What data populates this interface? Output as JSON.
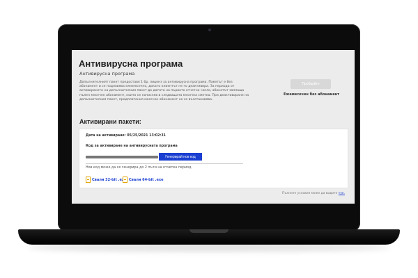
{
  "page": {
    "title": "Антивирусна програма",
    "subtitle": "Антивирусна програма",
    "description": "Допълнителният пакет предоставя 1 бр. лиценз за антивирусна програма. Пакетът е без абонамент и се подновява ежемесечно, докато клиентът не го деактивира. За периода от активирането на допълнителния пакет до датата на първото отчетно число, абонатът заплаща пълен месечен абонамент, които се начисляв в следващата месечна сметка. При деактивиране на допълнителния пакет, предплатения месечен абонамент не се възстановява.",
    "inactive_button": "Пробвайте",
    "monthly_label": "Ежемесечен без абонамент",
    "section_title": "Активирани пакети:"
  },
  "package": {
    "activation_date": "Дата на активиране: 05/25/2021 13:02:31",
    "code_label": "Код за активиране на антивирусната програма",
    "generate_button": "Генерирай нов код",
    "note": "Нов код може да се генерира до 2 пъти на отчетен период.",
    "download_32": "Свали 32-bit .exe",
    "download_64": "Свали 64-bit .exe"
  },
  "footer": {
    "text": "Пълните условия може да видите",
    "link": "тук."
  }
}
